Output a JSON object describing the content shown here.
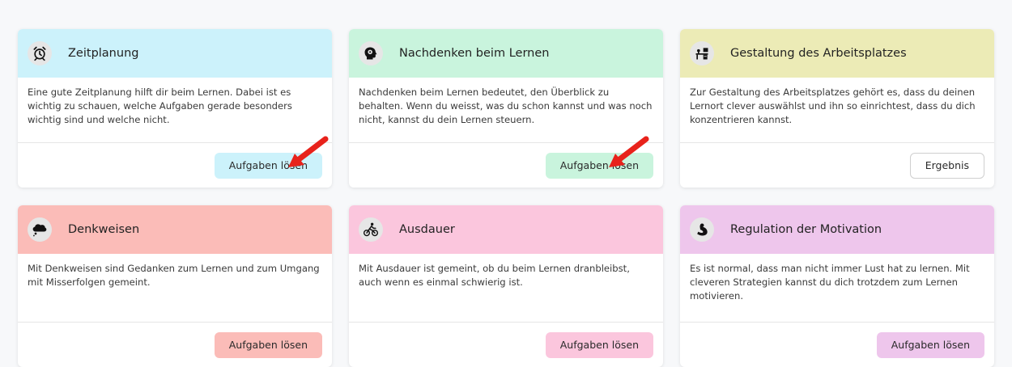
{
  "cards": [
    {
      "title": "Zeitplanung",
      "icon": "alarm-clock-icon",
      "header_color": "#ccf2fb",
      "text": "Eine gute Zeitplanung hilft dir beim Lernen. Dabei ist es wichtig zu schauen, welche Aufgaben gerade besonders wichtig sind und welche nicht.",
      "button": "Aufgaben lösen",
      "button_color": "#ccf2fb"
    },
    {
      "title": "Nachdenken beim Lernen",
      "icon": "head-brain-icon",
      "header_color": "#c9f4dd",
      "text": "Nachdenken beim Lernen bedeutet, den Überblick zu behalten. Wenn du weisst, was du schon kannst und was noch nicht, kannst du dein Lernen steuern.",
      "button": "Aufgaben lösen",
      "button_color": "#c9f4dd"
    },
    {
      "title": "Gestaltung des Arbeitsplatzes",
      "icon": "desk-icon",
      "header_color": "#ecebb6",
      "text": "Zur Gestaltung des Arbeitsplatzes gehört es, dass du deinen Lernort clever auswählst und ihn so einrichtest, dass du dich konzentrieren kannst.",
      "button": "Ergebnis",
      "button_color": "#ffffff"
    },
    {
      "title": "Denkweisen",
      "icon": "thought-bubble-icon",
      "header_color": "#fbbcb8",
      "text": "Mit Denkweisen sind Gedanken zum Lernen und zum Umgang mit Misserfolgen gemeint.",
      "button": "Aufgaben lösen",
      "button_color": "#fbbcb8"
    },
    {
      "title": "Ausdauer",
      "icon": "cyclist-icon",
      "header_color": "#fbc6dd",
      "text": "Mit Ausdauer ist gemeint, ob du beim Lernen dranbleibst, auch wenn es einmal schwierig ist.",
      "button": "Aufgaben lösen",
      "button_color": "#fbc6dd"
    },
    {
      "title": "Regulation der Motivation",
      "icon": "flexed-arm-icon",
      "header_color": "#eec6ec",
      "text": "Es ist normal, dass man nicht immer Lust hat zu lernen. Mit cleveren Strategien kannst du dich trotzdem zum Lernen motivieren.",
      "button": "Aufgaben lösen",
      "button_color": "#eec6ec"
    }
  ],
  "annotation_color": "#e8221b"
}
